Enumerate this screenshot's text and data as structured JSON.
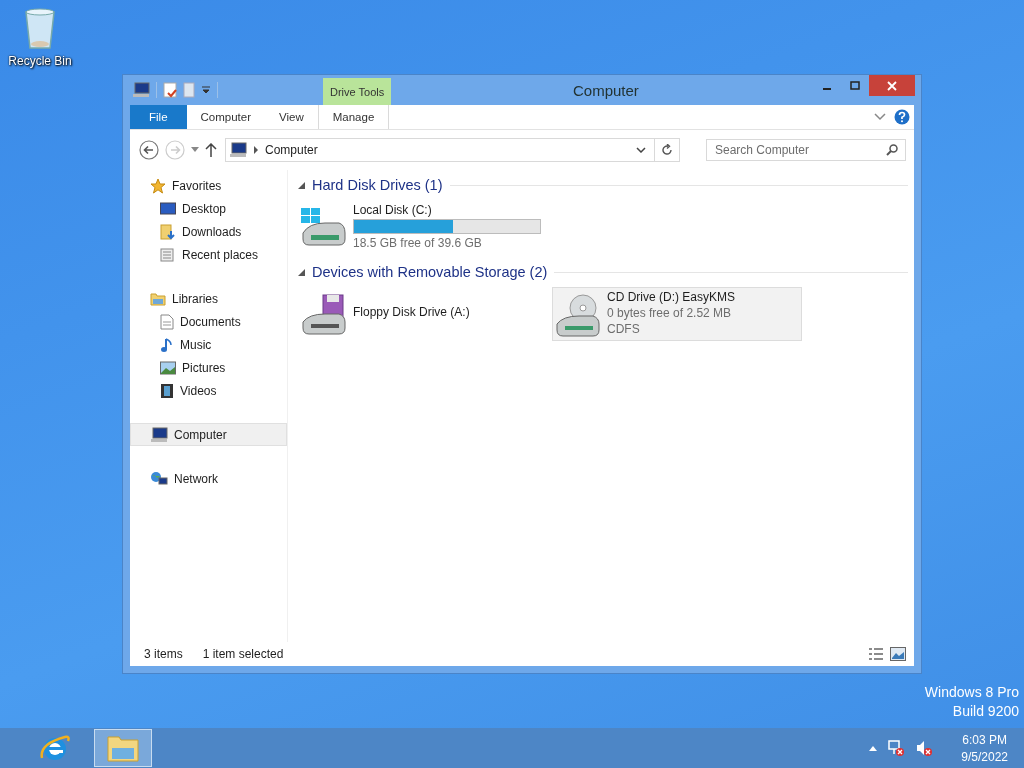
{
  "desktop": {
    "icons": [
      {
        "label": "Recycle Bin"
      }
    ],
    "edition": "Windows 8 Pro",
    "build": "Build 9200"
  },
  "window": {
    "title": "Computer",
    "context_group": "Drive Tools",
    "ribbon_tabs": [
      {
        "label": "File",
        "kind": "file",
        "selected": false
      },
      {
        "label": "Computer",
        "kind": "tab",
        "selected": false
      },
      {
        "label": "View",
        "kind": "tab",
        "selected": false
      },
      {
        "label": "Manage",
        "kind": "context",
        "selected": false
      }
    ],
    "address": "Computer",
    "search": {
      "placeholder": "Search Computer"
    },
    "nav": [
      {
        "label": "Favorites",
        "kind": "star",
        "selected": false,
        "children": [
          {
            "label": "Desktop",
            "kind": "desktop",
            "selected": false
          },
          {
            "label": "Downloads",
            "kind": "downloads",
            "selected": false
          },
          {
            "label": "Recent places",
            "kind": "recent",
            "selected": false
          }
        ]
      },
      {
        "label": "Libraries",
        "kind": "libraries",
        "selected": false,
        "children": [
          {
            "label": "Documents",
            "kind": "documents",
            "selected": false
          },
          {
            "label": "Music",
            "kind": "music",
            "selected": false
          },
          {
            "label": "Pictures",
            "kind": "pictures",
            "selected": false
          },
          {
            "label": "Videos",
            "kind": "videos",
            "selected": false
          }
        ]
      },
      {
        "label": "Computer",
        "kind": "computer",
        "selected": true
      },
      {
        "label": "Network",
        "kind": "network",
        "selected": false
      }
    ],
    "sections": [
      {
        "title": "Hard Disk Drives (1)",
        "items": [
          {
            "name": "Local Disk (C:)",
            "kind": "hdd",
            "level": 0.53,
            "details": [
              "18.5 GB free of 39.6 GB"
            ],
            "selected": false
          }
        ]
      },
      {
        "title": "Devices with Removable Storage (2)",
        "items": [
          {
            "name": "Floppy Disk Drive (A:)",
            "kind": "floppy",
            "selected": false
          },
          {
            "name": "CD Drive (D:) EasyKMS",
            "kind": "cd",
            "details": [
              "0 bytes free of 2.52 MB",
              "CDFS"
            ],
            "selected": true
          }
        ]
      }
    ],
    "status": {
      "count": "3 items",
      "selection": "1 item selected"
    }
  },
  "taskbar": {
    "apps": [
      {
        "kind": "browser",
        "selected": false
      },
      {
        "kind": "explorer",
        "selected": true
      }
    ],
    "time": "6:03 PM",
    "date": "9/5/2022"
  }
}
